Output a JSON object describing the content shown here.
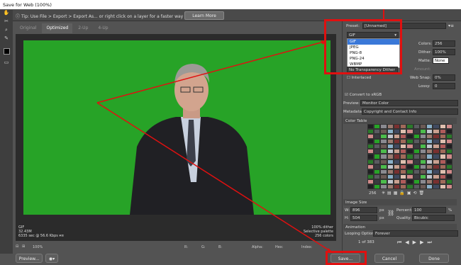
{
  "window": {
    "title": "Save for Web (100%)"
  },
  "tip": {
    "text": "Tip: Use File > Export > Export As... or right click on a layer for a faster way to export assets",
    "button": "Learn More"
  },
  "tabs": [
    "Original",
    "Optimized",
    "2-Up",
    "4-Up"
  ],
  "image_info": {
    "format": "GIF",
    "size": "32.43M",
    "time": "6335 sec @ 56.6 Kbps",
    "dither": "100% dither",
    "palette": "Selective palette",
    "colors": "256 colors"
  },
  "status": {
    "zoom": "100%",
    "r": "R:",
    "g": "G:",
    "b": "B:",
    "alpha": "Alpha:",
    "hex": "Hex:",
    "index": "Index:"
  },
  "buttons": {
    "preview": "Preview...",
    "save": "Save...",
    "cancel": "Cancel",
    "done": "Done"
  },
  "panel": {
    "preset_label": "Preset:",
    "preset_value": "[Unnamed]",
    "format_value": "GIF",
    "format_options": [
      "GIF",
      "JPEG",
      "PNG-8",
      "PNG-24",
      "WBMP"
    ],
    "colors_label": "Colors:",
    "colors_value": "256",
    "dither_label": "Dither:",
    "dither_value": "100%",
    "matte_label": "Matte:",
    "matte_value": "None",
    "transparency_dither": "No Transparency Dither",
    "amount_label": "Amount:",
    "interlaced": "Interlaced",
    "websnap_label": "Web Snap:",
    "websnap_value": "0%",
    "lossy_label": "Lossy:",
    "lossy_value": "0",
    "convert_srgb": "Convert to sRGB",
    "preview_label": "Preview:",
    "preview_value": "Monitor Color",
    "metadata_label": "Metadata:",
    "metadata_value": "Copyright and Contact Info",
    "color_table_title": "Color Table",
    "color_count": "256",
    "image_size_title": "Image Size",
    "w_label": "W:",
    "w_value": "896",
    "h_label": "H:",
    "h_value": "504",
    "px": "px",
    "percent_label": "Percent:",
    "percent_value": "100",
    "pct": "%",
    "quality_label": "Quality:",
    "quality_value": "Bicubic",
    "animation_title": "Animation",
    "looping_label": "Looping Options:",
    "looping_value": "Forever",
    "frame_counter": "1 of 383"
  },
  "colors": {
    "green_screen": "#27a327",
    "highlight": "#e01010",
    "accent": "#3a78d8"
  }
}
